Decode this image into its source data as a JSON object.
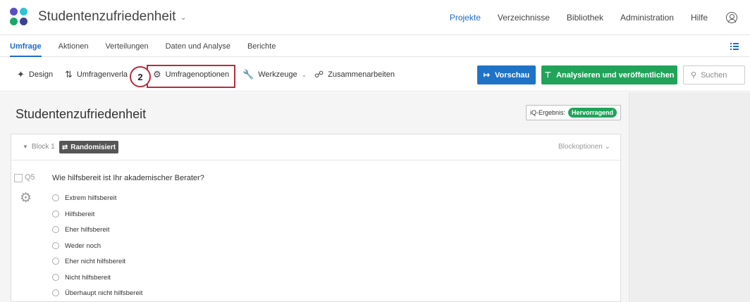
{
  "header": {
    "project_title": "Studentenzufriedenheit",
    "nav": [
      "Projekte",
      "Verzeichnisse",
      "Bibliothek",
      "Administration",
      "Hilfe"
    ],
    "active_nav": "Projekte",
    "logo_colors": [
      "#5b4fc3",
      "#2ec4d8",
      "#19a867",
      "#3b3f95"
    ]
  },
  "tabs": [
    "Umfrage",
    "Aktionen",
    "Verteilungen",
    "Daten und Analyse",
    "Berichte"
  ],
  "toolbar": {
    "design": "Design",
    "flow": "Umfragenverla",
    "options": "Umfragenoptionen",
    "tools": "Werkzeuge",
    "collab": "Zusammenarbeiten",
    "step_number": "2",
    "preview": "Vorschau",
    "publish": "Analysieren und veröffentlichen",
    "search_placeholder": "Suchen"
  },
  "survey": {
    "title": "Studentenzufriedenheit",
    "iq_label": "iQ-Ergebnis:",
    "iq_value": "Hervorragend"
  },
  "block": {
    "name": "Block 1",
    "badge": "Randomisiert",
    "options": "Blockoptionen"
  },
  "question": {
    "id": "Q5",
    "text": "Wie hilfsbereit ist Ihr akademischer Berater?",
    "choices": [
      "Extrem hilfsbereit",
      "Hilfsbereit",
      "Eher hilfsbereit",
      "Weder noch",
      "Eher nicht hilfsbereit",
      "Nicht hilfsbereit",
      "Überhaupt nicht hilfsbereit"
    ]
  },
  "colors": {
    "accent_blue": "#1d6bc8",
    "preview_blue": "#1f73c6",
    "publish_green": "#21a45a",
    "highlight_red": "#b82c3c"
  }
}
